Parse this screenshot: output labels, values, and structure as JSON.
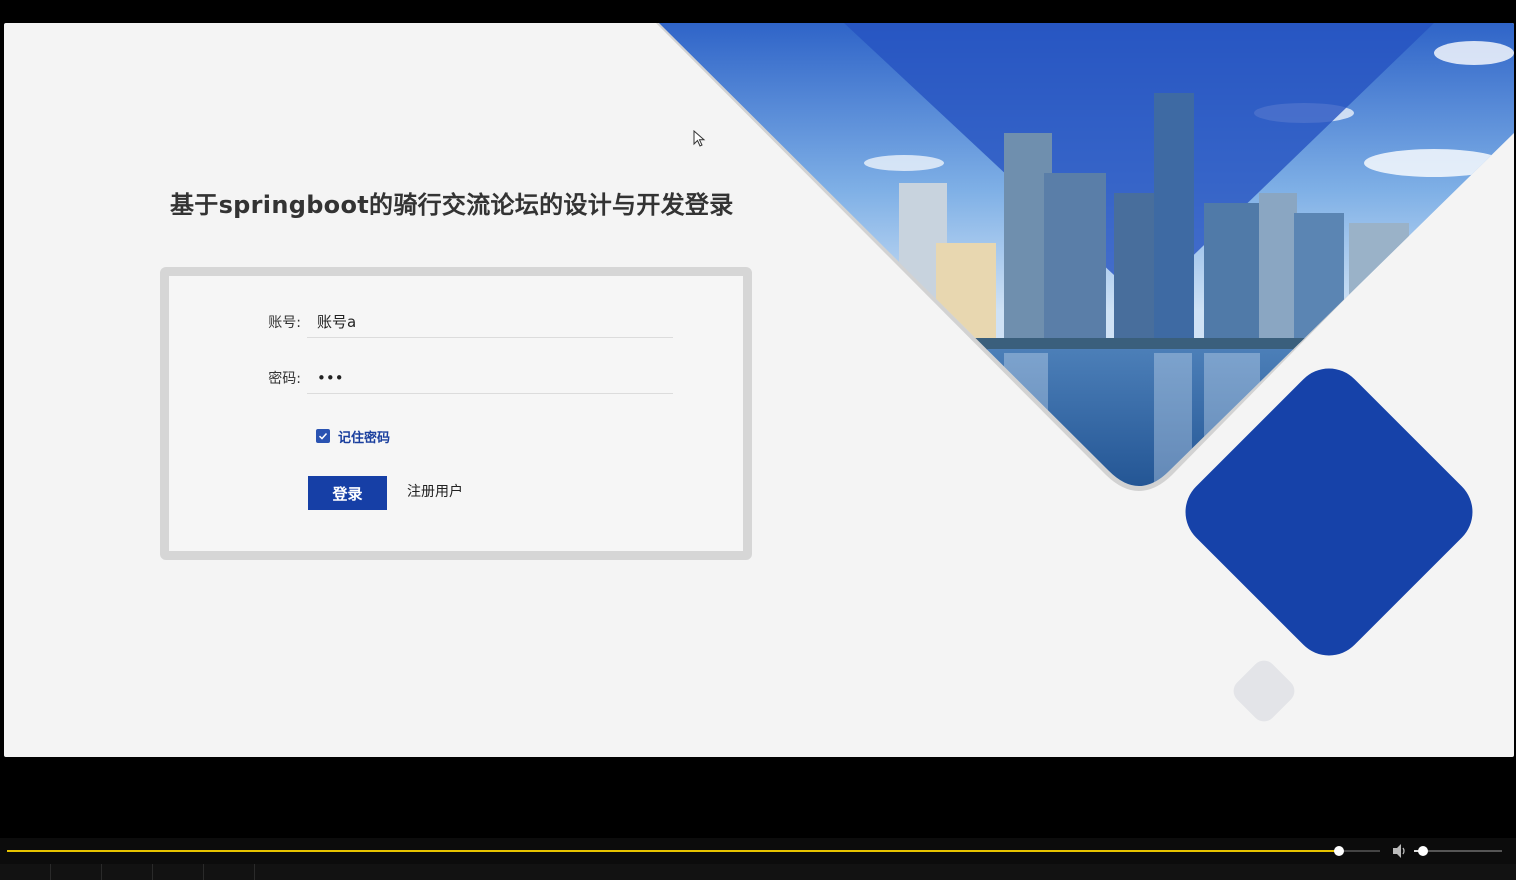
{
  "page": {
    "title": "基于springboot的骑行交流论坛的设计与开发登录"
  },
  "form": {
    "account_label": "账号:",
    "account_value": "账号a",
    "password_label": "密码:",
    "password_value": "abc",
    "remember_label": "记住密码",
    "remember_checked": true,
    "login_button": "登录",
    "register_link": "注册用户"
  },
  "colors": {
    "primary_blue": "#163fa6",
    "page_bg": "#f4f4f4",
    "progress_accent": "#e6c300"
  },
  "player": {
    "progress": 0.97,
    "volume": 0.1
  },
  "icons": {
    "checkbox": "check-icon",
    "cursor": "mouse-pointer-icon",
    "volume": "speaker-icon"
  }
}
